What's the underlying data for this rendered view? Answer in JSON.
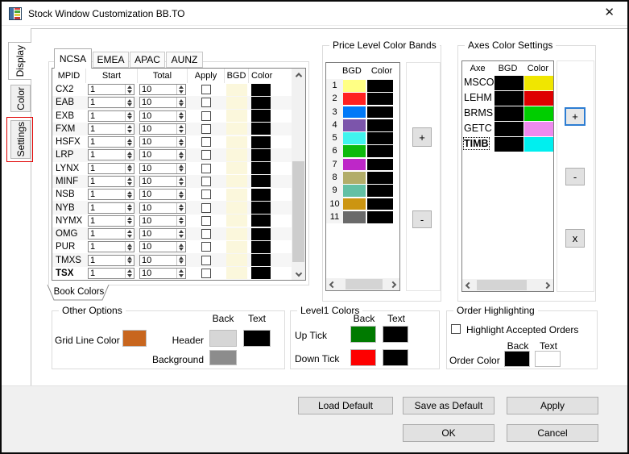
{
  "window": {
    "title": "Stock Window Customization BB.TO",
    "close_icon": "✕"
  },
  "side_tabs": [
    {
      "label": "Display"
    },
    {
      "label": "Color"
    },
    {
      "label": "Settings"
    }
  ],
  "region_tabs": [
    {
      "label": "NCSA"
    },
    {
      "label": "EMEA"
    },
    {
      "label": "APAC"
    },
    {
      "label": "AUNZ"
    }
  ],
  "book_colors_tab": {
    "label": "Book Colors"
  },
  "book_table": {
    "columns": [
      "MPID",
      "Start",
      "Total",
      "Apply",
      "BGD",
      "Color"
    ],
    "rows": [
      {
        "mpid": "CX2",
        "start": "1",
        "total": "10",
        "apply_checked": false,
        "bgd": "#FBF7DC",
        "color": "#000000"
      },
      {
        "mpid": "EAB",
        "start": "1",
        "total": "10",
        "apply_checked": false,
        "bgd": "#FBF7DC",
        "color": "#000000"
      },
      {
        "mpid": "EXB",
        "start": "1",
        "total": "10",
        "apply_checked": false,
        "bgd": "#FBF7DC",
        "color": "#000000"
      },
      {
        "mpid": "FXM",
        "start": "1",
        "total": "10",
        "apply_checked": false,
        "bgd": "#FBF7DC",
        "color": "#000000"
      },
      {
        "mpid": "HSFX",
        "start": "1",
        "total": "10",
        "apply_checked": false,
        "bgd": "#FBF7DC",
        "color": "#000000"
      },
      {
        "mpid": "LRP",
        "start": "1",
        "total": "10",
        "apply_checked": false,
        "bgd": "#FBF7DC",
        "color": "#000000"
      },
      {
        "mpid": "LYNX",
        "start": "1",
        "total": "10",
        "apply_checked": false,
        "bgd": "#FBF7DC",
        "color": "#000000"
      },
      {
        "mpid": "MINF",
        "start": "1",
        "total": "10",
        "apply_checked": false,
        "bgd": "#FBF7DC",
        "color": "#000000"
      },
      {
        "mpid": "NSB",
        "start": "1",
        "total": "10",
        "apply_checked": false,
        "bgd": "#FBF7DC",
        "color": "#000000"
      },
      {
        "mpid": "NYB",
        "start": "1",
        "total": "10",
        "apply_checked": false,
        "bgd": "#FBF7DC",
        "color": "#000000"
      },
      {
        "mpid": "NYMX",
        "start": "1",
        "total": "10",
        "apply_checked": false,
        "bgd": "#FBF7DC",
        "color": "#000000"
      },
      {
        "mpid": "OMG",
        "start": "1",
        "total": "10",
        "apply_checked": false,
        "bgd": "#FBF7DC",
        "color": "#000000"
      },
      {
        "mpid": "PUR",
        "start": "1",
        "total": "10",
        "apply_checked": false,
        "bgd": "#FBF7DC",
        "color": "#000000"
      },
      {
        "mpid": "TMXS",
        "start": "1",
        "total": "10",
        "apply_checked": false,
        "bgd": "#FBF7DC",
        "color": "#000000"
      },
      {
        "mpid": "TSX",
        "start": "1",
        "total": "10",
        "apply_checked": false,
        "bgd": "#FBF7DC",
        "color": "#000000",
        "bold": true
      }
    ]
  },
  "price_bands": {
    "title": "Price Level Color Bands",
    "columns": [
      "BGD",
      "Color"
    ],
    "rows": [
      {
        "n": "1",
        "bgd": "#FFFF84",
        "color": "#000000"
      },
      {
        "n": "2",
        "bgd": "#FF2121",
        "color": "#000000"
      },
      {
        "n": "3",
        "bgd": "#0079F8",
        "color": "#000000"
      },
      {
        "n": "4",
        "bgd": "#7C55AB",
        "color": "#000000"
      },
      {
        "n": "5",
        "bgd": "#41F4EE",
        "color": "#000000"
      },
      {
        "n": "6",
        "bgd": "#0DBA0D",
        "color": "#000000"
      },
      {
        "n": "7",
        "bgd": "#BE27C8",
        "color": "#000000"
      },
      {
        "n": "8",
        "bgd": "#B2AD69",
        "color": "#000000"
      },
      {
        "n": "9",
        "bgd": "#63C0A4",
        "color": "#000000"
      },
      {
        "n": "10",
        "bgd": "#CC9511",
        "color": "#000000"
      },
      {
        "n": "11",
        "bgd": "#6A6A6A",
        "color": "#000000"
      }
    ],
    "add_label": "+",
    "remove_label": "-"
  },
  "axes": {
    "title": "Axes Color Settings",
    "columns": [
      "Axe",
      "BGD",
      "Color"
    ],
    "rows": [
      {
        "axe": "MSCO",
        "bgd": "#000000",
        "color": "#F0E600"
      },
      {
        "axe": "LEHM",
        "bgd": "#000000",
        "color": "#DE0000"
      },
      {
        "axe": "BRMS",
        "bgd": "#000000",
        "color": "#00CE00"
      },
      {
        "axe": "GETC",
        "bgd": "#000000",
        "color": "#EE8AEE"
      },
      {
        "axe": "TIMB",
        "bgd": "#000000",
        "color": "#00EFEF",
        "selected": true
      }
    ],
    "add_label": "+",
    "remove_label": "-",
    "delete_label": "x"
  },
  "other_options": {
    "title": "Other Options",
    "back_header": "Back",
    "text_header": "Text",
    "grid_line_label": "Grid Line Color",
    "grid_line_color": "#C8661E",
    "header_label": "Header",
    "header_back": "#D6D6D6",
    "header_text": "#000000",
    "background_label": "Background",
    "background_color": "#8C8C8C"
  },
  "level1": {
    "title": "Level1 Colors",
    "back_header": "Back",
    "text_header": "Text",
    "rows": [
      {
        "label": "Up Tick",
        "back": "#007A00",
        "text": "#000000"
      },
      {
        "label": "Down Tick",
        "back": "#FE0000",
        "text": "#000000"
      }
    ]
  },
  "order": {
    "title": "Order Highlighting",
    "checkbox_label": "Highlight Accepted Orders",
    "checkbox_checked": false,
    "back_header": "Back",
    "text_header": "Text",
    "color_label": "Order Color",
    "back": "#000000",
    "text": "#FFFFFF"
  },
  "footer": {
    "load_default": "Load Default",
    "save_as_default": "Save as Default",
    "apply": "Apply",
    "ok": "OK",
    "cancel": "Cancel"
  }
}
